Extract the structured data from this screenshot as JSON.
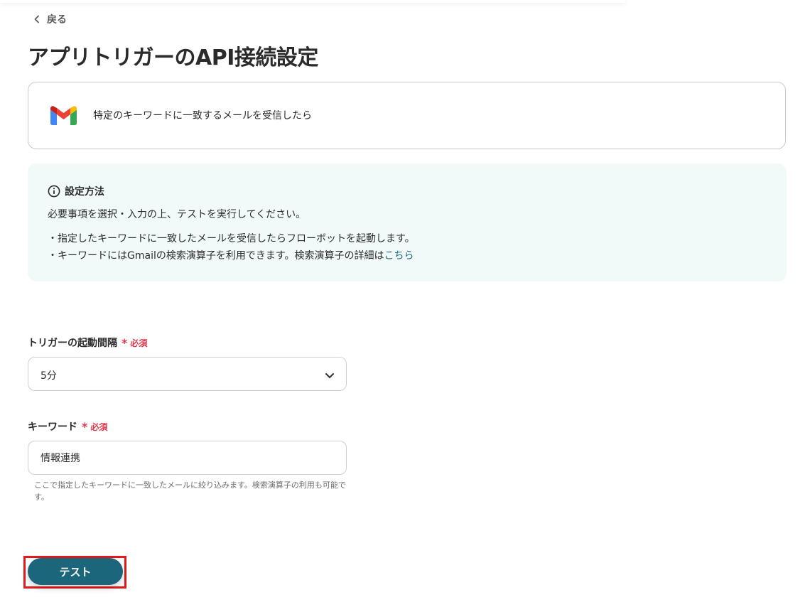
{
  "nav": {
    "back_label": "戻る"
  },
  "page": {
    "title": "アプリトリガーのAPI接続設定"
  },
  "trigger": {
    "app_icon": "gmail-logo",
    "description": "特定のキーワードに一致するメールを受信したら"
  },
  "info": {
    "heading": "設定方法",
    "intro": "必要事項を選択・入力の上、テストを実行してください。",
    "bullet_1": "・指定したキーワードに一致したメールを受信したらフローボットを起動します。",
    "bullet_2": "・キーワードにはGmailの検索演算子を利用できます。検索演算子の詳細は",
    "bullet_2_link": "こちら"
  },
  "form": {
    "interval": {
      "label": "トリガーの起動間隔",
      "required_star": "*",
      "required_text": "必須",
      "selected_value": "5分"
    },
    "keyword": {
      "label": "キーワード",
      "required_star": "*",
      "required_text": "必須",
      "value": "情報連携",
      "help": "ここで指定したキーワードに一致したメールに絞り込みます。検索演算子の利用も可能です。"
    }
  },
  "actions": {
    "test_label": "テスト"
  },
  "colors": {
    "primary": "#1b667a",
    "link": "#1c6d80",
    "required": "#e0374a",
    "info_bg": "#f1faf9",
    "highlight": "#e01b1b"
  }
}
